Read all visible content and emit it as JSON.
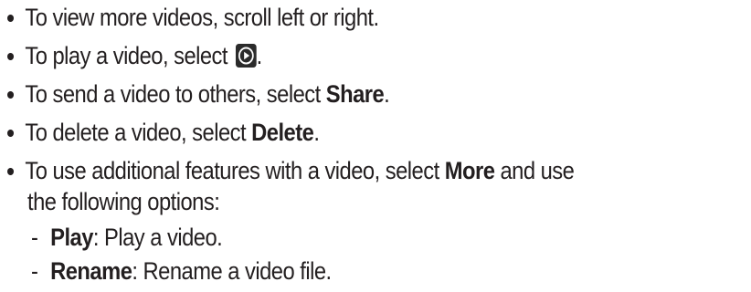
{
  "items": [
    {
      "text": "To view more videos, scroll left or right."
    },
    {
      "prefix": "To play a video, select ",
      "suffix": ".",
      "icon": "play-button-icon"
    },
    {
      "prefix": "To send a video to others, select ",
      "bold": "Share",
      "suffix": "."
    },
    {
      "prefix": "To delete a video, select ",
      "bold": "Delete",
      "suffix": "."
    },
    {
      "prefix": "To use additional features with a video, select ",
      "bold": "More",
      "suffix": " and use",
      "continuation": "the following options:"
    }
  ],
  "options": [
    {
      "dash": "-",
      "name": "Play",
      "desc": ": Play a video."
    },
    {
      "dash": "-",
      "name": "Rename",
      "desc": ": Rename a video file."
    }
  ],
  "colors": {
    "text": "#231f20",
    "icon_bg": "#2b2b2b",
    "icon_fg": "#ffffff"
  }
}
